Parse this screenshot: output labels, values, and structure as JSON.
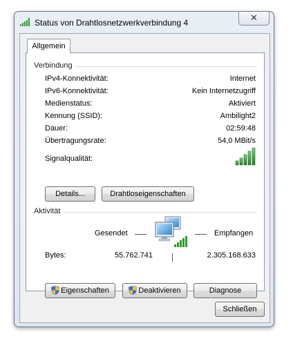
{
  "window": {
    "title": "Status von Drahtlosnetzwerkverbindung 4",
    "close_glyph": "✕"
  },
  "tab": {
    "label": "Allgemein"
  },
  "connection": {
    "heading": "Verbindung",
    "rows": [
      {
        "label": "IPv4-Konnektivität:",
        "value": "Internet"
      },
      {
        "label": "IPv6-Konnektivität:",
        "value": "Kein Internetzugriff"
      },
      {
        "label": "Medienstatus:",
        "value": "Aktiviert"
      },
      {
        "label": "Kennung (SSID):",
        "value": "Ambilight2"
      },
      {
        "label": "Dauer:",
        "value": "02:59:48"
      },
      {
        "label": "Übertragungsrate:",
        "value": "54,0 MBit/s"
      }
    ],
    "signal": {
      "label": "Signalqualität:",
      "bars_filled": 5,
      "bars_total": 5
    },
    "buttons": {
      "details": "Details...",
      "wireless_properties": "Drahtloseigenschaften"
    }
  },
  "activity": {
    "heading": "Aktivität",
    "sent_label": "Gesendet",
    "received_label": "Empfangen",
    "bytes_label": "Bytes:",
    "bytes_sent": "55.762.741",
    "bytes_received": "2.305.168.633"
  },
  "action_buttons": {
    "properties": "Eigenschaften",
    "disable": "Deaktivieren",
    "diagnose": "Diagnose"
  },
  "footer": {
    "close": "Schließen"
  },
  "colors": {
    "signal_green": "#2e9a2e",
    "panel_border": "#8d98a8",
    "shield_blue": "#3a6fc4",
    "shield_yellow": "#f2c431"
  },
  "icons": [
    "wireless-signal-icon",
    "network-computer-icon",
    "uac-shield-icon"
  ]
}
